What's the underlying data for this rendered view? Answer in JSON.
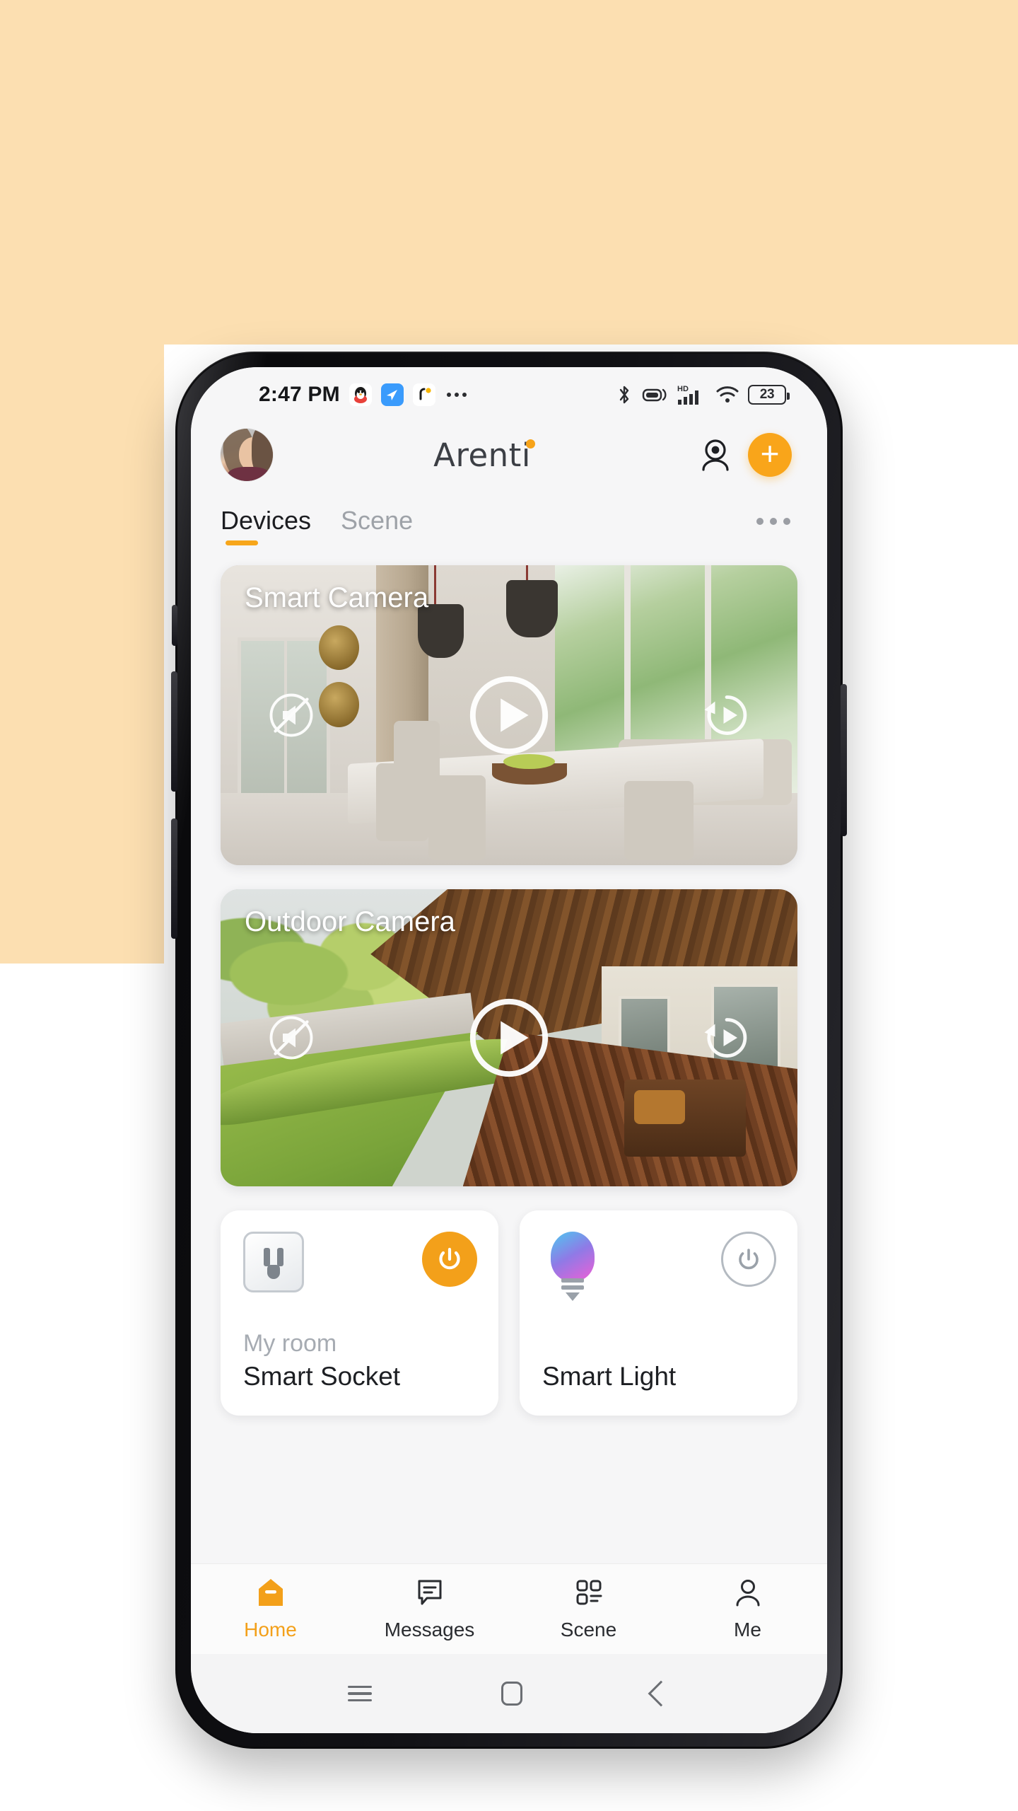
{
  "status_bar": {
    "time": "2:47 PM",
    "app_icons": [
      {
        "name": "qq-icon",
        "glyph": "🐧"
      },
      {
        "name": "dingtalk-icon",
        "glyph": "✈"
      },
      {
        "name": "notification-icon",
        "glyph": "ꕤ"
      }
    ],
    "overflow_label": "more notifications",
    "right_icons": [
      "bluetooth-icon",
      "vibrate-icon",
      "hd-signal-icon",
      "wifi-icon",
      "battery-icon"
    ],
    "battery_level": "23"
  },
  "header": {
    "avatar_label": "profile avatar",
    "brand": "Arenti",
    "camera_icon_label": "webcam-icon",
    "add_label": "+"
  },
  "tabs": {
    "items": [
      {
        "label": "Devices",
        "active": true
      },
      {
        "label": "Scene",
        "active": false
      }
    ],
    "more_label": "more options"
  },
  "devices": {
    "cameras": [
      {
        "title": "Smart Camera",
        "mute_icon": "mute-icon",
        "play_icon": "play-icon",
        "playback_icon": "playback-icon"
      },
      {
        "title": "Outdoor Camera",
        "mute_icon": "mute-icon",
        "play_icon": "play-icon",
        "playback_icon": "playback-icon"
      }
    ],
    "tiles": [
      {
        "room": "My room",
        "name": "Smart Socket",
        "icon": "socket-icon",
        "power": "on"
      },
      {
        "room": "",
        "name": "Smart Light",
        "icon": "bulb-icon",
        "power": "off"
      }
    ]
  },
  "bottom_nav": {
    "items": [
      {
        "label": "Home",
        "icon": "home-icon",
        "active": true
      },
      {
        "label": "Messages",
        "icon": "message-icon",
        "active": false
      },
      {
        "label": "Scene",
        "icon": "scene-grid-icon",
        "active": false
      },
      {
        "label": "Me",
        "icon": "person-icon",
        "active": false
      }
    ]
  },
  "system_nav": {
    "recents_label": "recents",
    "home_label": "home",
    "back_label": "back"
  },
  "colors": {
    "accent": "#f3a01a",
    "background_peach": "#fcdfb1",
    "app_background": "#f6f6f7",
    "text_primary": "#1d1f23",
    "text_muted": "#a6abb2"
  }
}
